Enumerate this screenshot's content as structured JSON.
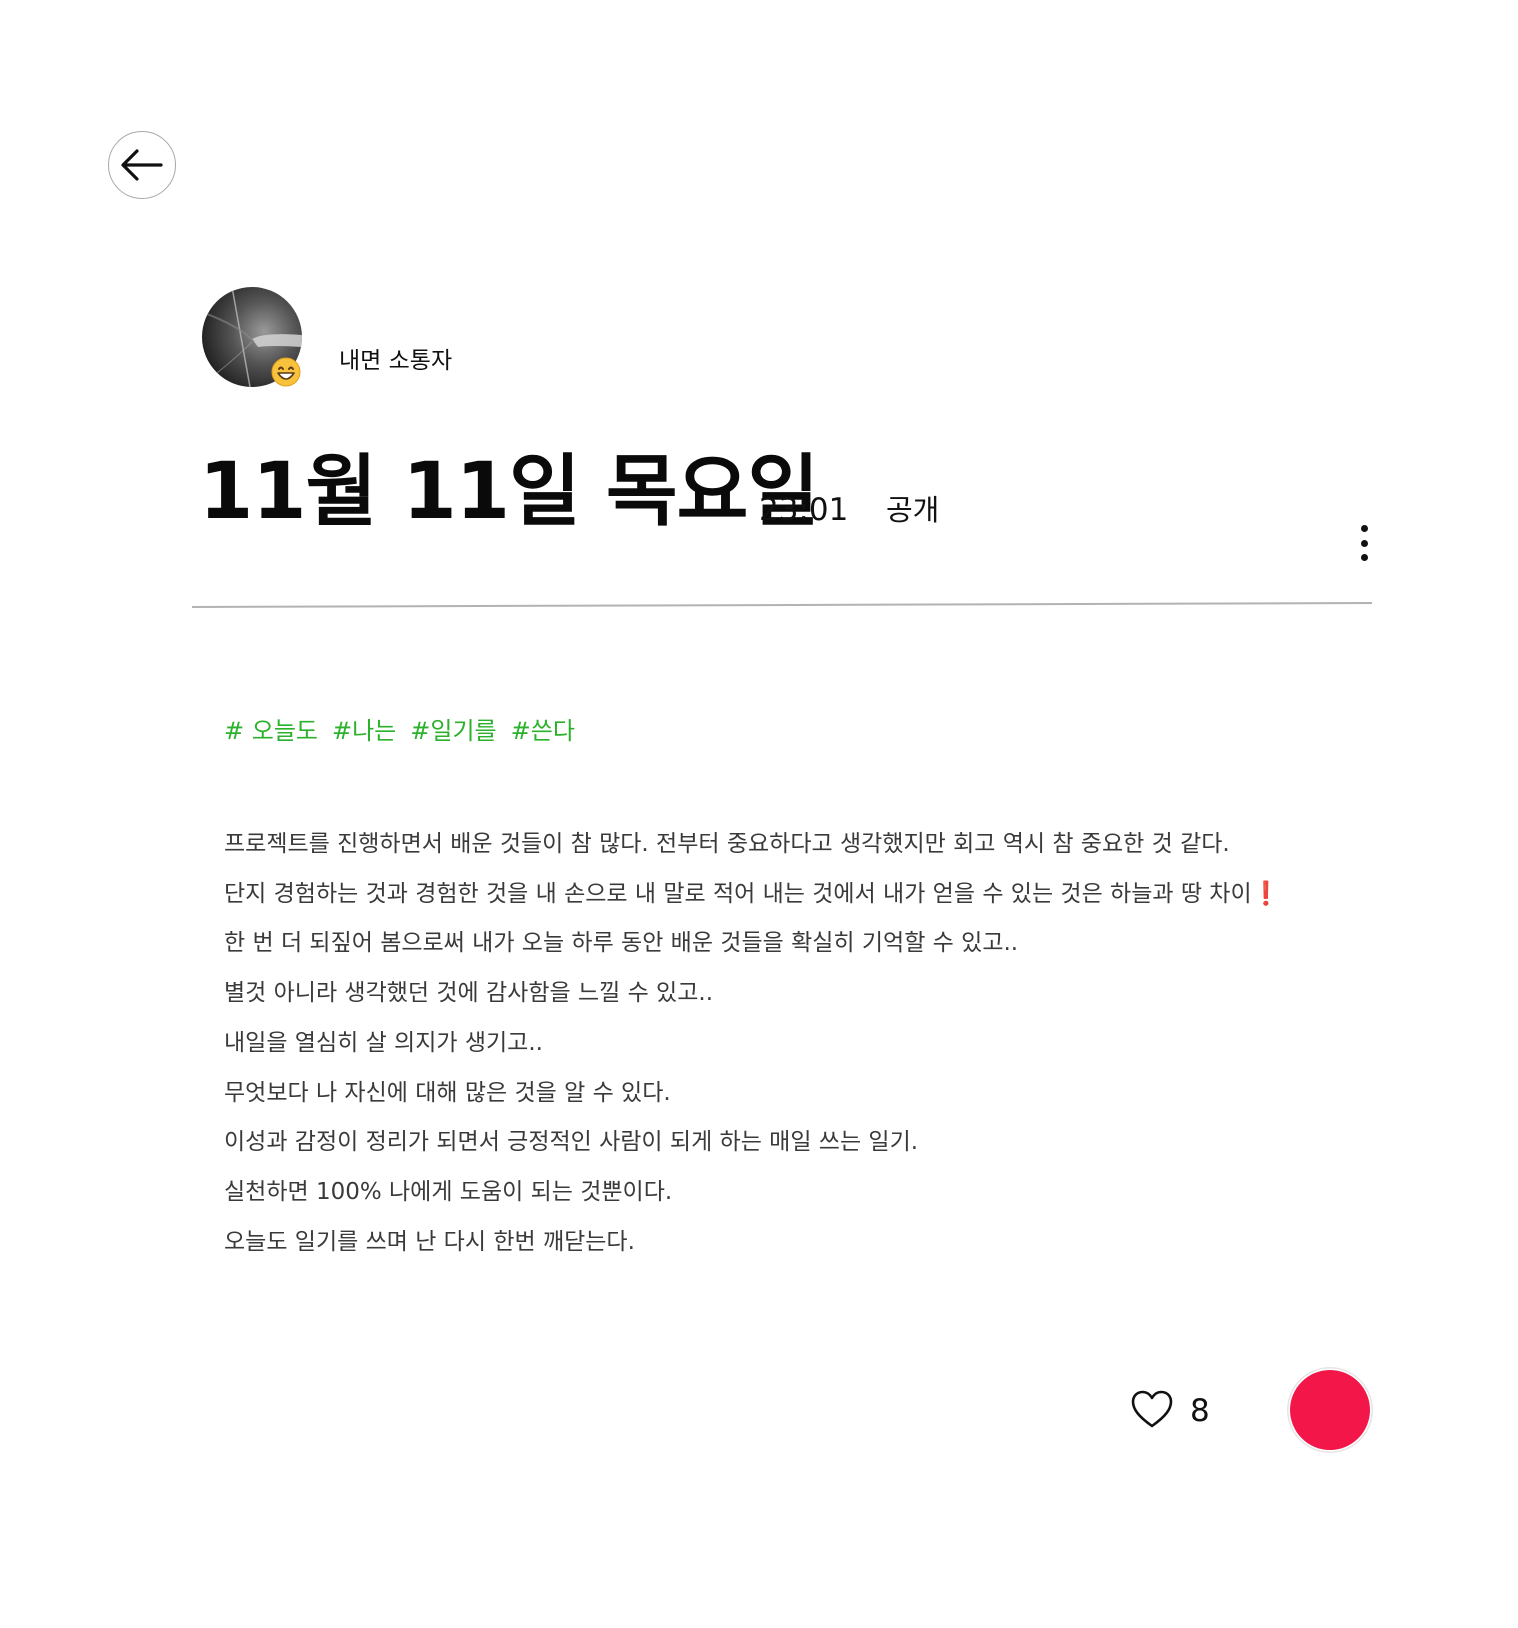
{
  "header": {
    "back_icon": "arrow-left-icon"
  },
  "author": {
    "name": "내면 소통자",
    "avatar_icon": "profile-photo",
    "mood_icon": "grinning-face-emoji"
  },
  "entry": {
    "title": "11월 11일 목요일",
    "time": "23:01",
    "visibility": "공개",
    "more_icon": "vertical-ellipsis-icon"
  },
  "tags": [
    "# 오늘도",
    "#나는",
    "#일기를",
    "#쓴다"
  ],
  "body": {
    "lines": [
      "프로젝트를 진행하면서 배운 것들이 참 많다. 전부터 중요하다고 생각했지만 회고 역시 참 중요한 것 같다.",
      "단지 경험하는 것과 경험한 것을 내 손으로 내 말로 적어 내는 것에서 내가 얻을 수 있는 것은 하늘과 땅 차이",
      "한 번 더 되짚어 봄으로써 내가 오늘 하루 동안 배운 것들을 확실히 기억할 수 있고..",
      "별것 아니라 생각했던 것에 감사함을 느낄 수 있고..",
      "내일을 열심히 살 의지가 생기고..",
      "무엇보다 나 자신에 대해 많은 것을 알 수 있다.",
      "이성과 감정이 정리가 되면서 긍정적인 사람이 되게 하는 매일 쓰는 일기.",
      "실천하면 100% 나에게 도움이 되는 것뿐이다.",
      "오늘도 일기를 쓰며 난 다시 한번 깨닫는다."
    ],
    "emphasis_mark": "❗"
  },
  "actions": {
    "like_icon": "heart-outline-icon",
    "like_count": "8",
    "record_icon": "red-circle-button"
  },
  "colors": {
    "tag": "#2bb12b",
    "body_text": "#3a3a3a",
    "record": "#f21748",
    "exclaim": "#e0211b"
  }
}
